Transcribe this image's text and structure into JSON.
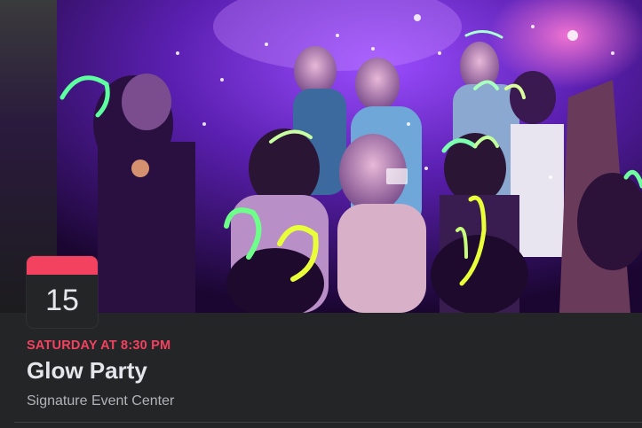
{
  "event": {
    "date_day": "15",
    "when": "SATURDAY AT 8:30 PM",
    "title": "Glow Party",
    "venue": "Signature Event Center"
  },
  "colors": {
    "accent": "#f3425f",
    "background": "#242526",
    "primary_text": "#e4e6eb",
    "secondary_text": "#b0b3b8"
  },
  "cover_image": {
    "description_icon": "party-photo"
  }
}
